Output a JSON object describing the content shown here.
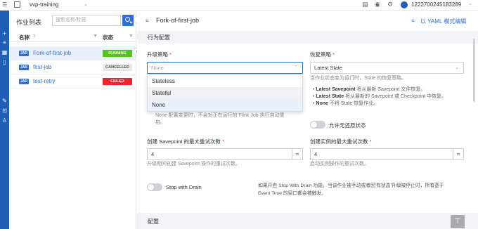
{
  "topbar": {
    "project": "vvp-training",
    "user": "1222700245183289"
  },
  "left_panel": {
    "title": "作业列表",
    "search_placeholder": "搜索名称/标签",
    "col_name": "名称",
    "col_status": "状态",
    "jobs": [
      {
        "tag": "JAR",
        "name": "Fork-of-first-job",
        "status": "RUNNING",
        "status_color": "#52c41a"
      },
      {
        "tag": "JAR",
        "name": "first-job",
        "status": "CANCELLED",
        "status_color": "#e8e8e8"
      },
      {
        "tag": "JAR",
        "name": "test-retry",
        "status": "FAILED",
        "status_color": "#f5222d"
      }
    ]
  },
  "main": {
    "job_title": "Fork-of-first-job",
    "yaml_link": "以 YAML 模式编辑",
    "section_behavior": "行为配置",
    "upgrade_label": "升级策略",
    "upgrade_value": "None",
    "upgrade_options": [
      "Stateless",
      "Stateful",
      "None"
    ],
    "upgrade_help": "None 配置变更时，不会对正在运行的 Flink Job 执行自动重",
    "upgrade_help2": "启。",
    "restore_label": "恢复策略",
    "restore_value": "Latest State",
    "restore_help": "当作业状态变为运行时，State 的恢复策略。",
    "restore_bullets": [
      {
        "bold": "Latest Savepoint",
        "text": " 将从最新 Savepoint 文件恢复。"
      },
      {
        "bold": "Latest State",
        "text": " 将从最新的 Savepoint 或 Checkpoint 中恢复。"
      },
      {
        "bold": "None",
        "text": " 不将 State 恢复作业。"
      }
    ],
    "allow_unrestored": "允许无还原状态",
    "savepoint_retry_label": "创建 Savepoint 的最大重试次数",
    "savepoint_retry_value": "4",
    "savepoint_retry_help": "升级期间创建 Savepoint 操作的重试次数。",
    "instance_retry_label": "创建实例的最大重试次数",
    "instance_retry_value": "4",
    "instance_retry_help": "启动实例操作的重试次数。",
    "stop_with_drain": "Stop with Drain",
    "drain_help1": "如果开启 Stop With Drain 功能，当该作业被手动或者因'有状态'升级被停止时，所有基于",
    "drain_help2": "Event Time 的窗口都会被触发。",
    "section_config": "配置"
  },
  "colors": {
    "rail": "#1f5fb8",
    "accent": "#2d6fd6",
    "running": "#52c41a",
    "failed": "#f5222d",
    "selected_row": "#e8f1fc"
  }
}
